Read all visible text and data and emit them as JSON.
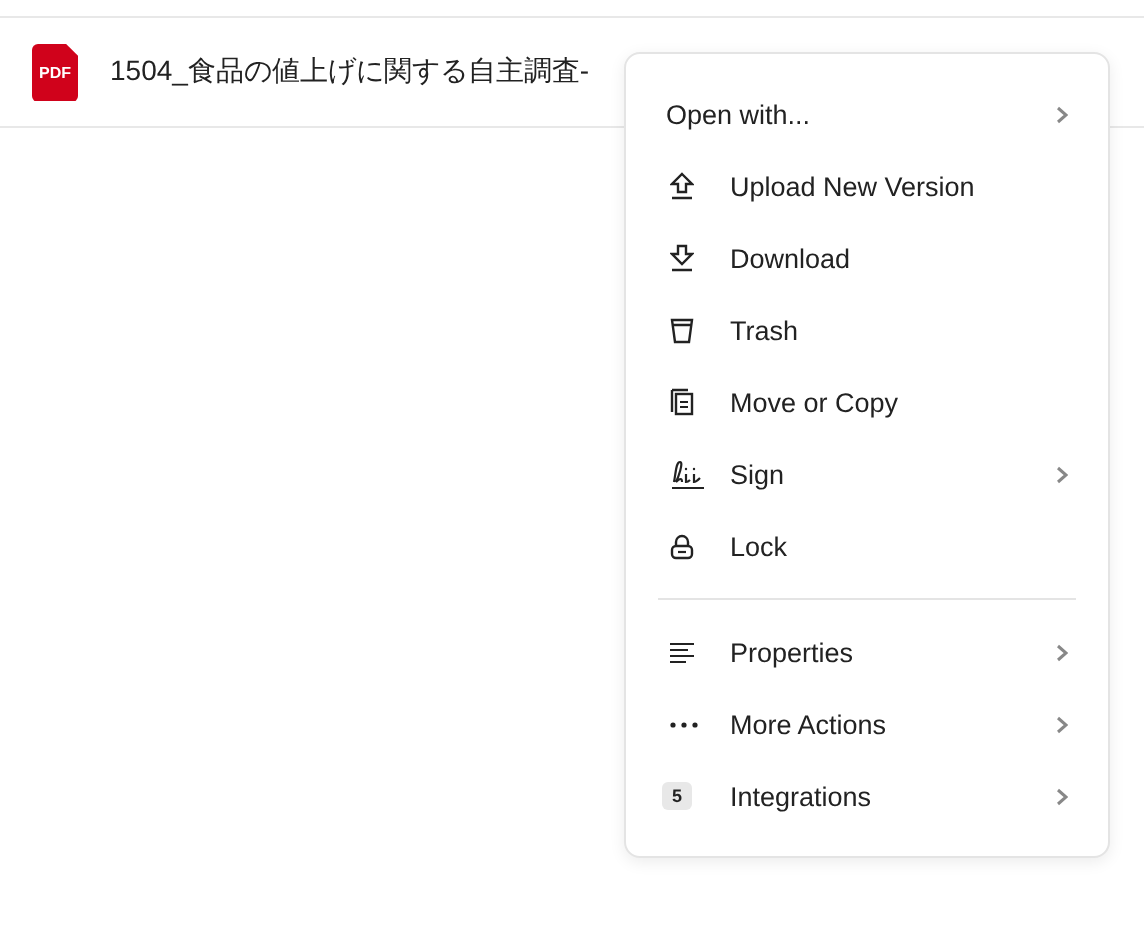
{
  "file": {
    "type_label": "PDF",
    "name": "1504_食品の値上げに関する自主調査-"
  },
  "menu": {
    "sections": [
      {
        "items": [
          {
            "label": "Open with...",
            "kind": "plain",
            "submenu": true
          },
          {
            "label": "Upload New Version",
            "kind": "upload",
            "submenu": false
          },
          {
            "label": "Download",
            "kind": "download",
            "submenu": false
          },
          {
            "label": "Trash",
            "kind": "trash",
            "submenu": false
          },
          {
            "label": "Move or Copy",
            "kind": "copy",
            "submenu": false
          },
          {
            "label": "Sign",
            "kind": "sign",
            "submenu": true
          },
          {
            "label": "Lock",
            "kind": "lock",
            "submenu": false
          }
        ]
      },
      {
        "items": [
          {
            "label": "Properties",
            "kind": "properties",
            "submenu": true
          },
          {
            "label": "More Actions",
            "kind": "more",
            "submenu": true
          },
          {
            "label": "Integrations",
            "kind": "count",
            "badge": "5",
            "submenu": true
          }
        ]
      }
    ]
  }
}
